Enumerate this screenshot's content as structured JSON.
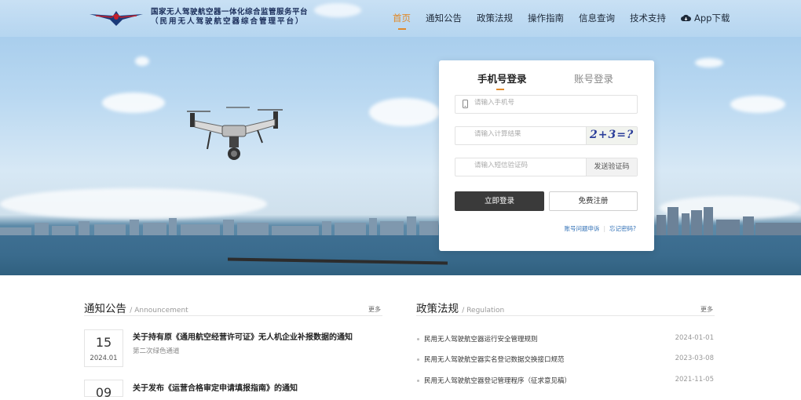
{
  "header": {
    "logo_line1": "国家无人驾驶航空器一体化综合监管服务平台",
    "logo_line2": "（民用无人驾驶航空器综合管理平台）",
    "nav": [
      {
        "label": "首页",
        "active": true
      },
      {
        "label": "通知公告",
        "active": false
      },
      {
        "label": "政策法规",
        "active": false
      },
      {
        "label": "操作指南",
        "active": false
      },
      {
        "label": "信息查询",
        "active": false
      },
      {
        "label": "技术支持",
        "active": false
      }
    ],
    "app_download": "App下载"
  },
  "login": {
    "tabs": [
      "手机号登录",
      "账号登录"
    ],
    "phone_placeholder": "请输入手机号",
    "calc_placeholder": "请输入计算结果",
    "captcha_text": "2+3=?",
    "sms_placeholder": "请输入短信验证码",
    "send_code": "发送验证码",
    "login_button": "立即登录",
    "register_button": "免费注册",
    "account_issue_link": "账号问题申诉",
    "forgot_password_link": "忘记密码?"
  },
  "notices": {
    "title": "通知公告",
    "title_en": "Announcement",
    "more": "更多",
    "items": [
      {
        "day": "15",
        "ym": "2024.01",
        "title": "关于持有原《通用航空经营许可证》无人机企业补报数据的通知",
        "sub": "第二次绿色通道"
      },
      {
        "day": "09",
        "ym": "",
        "title": "关于发布《运营合格审定申请填报指南》的通知",
        "sub": ""
      }
    ]
  },
  "policies": {
    "title": "政策法规",
    "title_en": "Regulation",
    "more": "更多",
    "items": [
      {
        "title": "民用无人驾驶航空器运行安全管理规则",
        "date": "2024-01-01"
      },
      {
        "title": "民用无人驾驶航空器实名登记数据交换接口规范",
        "date": "2023-03-08"
      },
      {
        "title": "民用无人驾驶航空器登记管理程序（征求意见稿）",
        "date": "2021-11-05"
      }
    ]
  },
  "colors": {
    "accent": "#e0892a",
    "primary_dark": "#3a3a3a",
    "link": "#2f6fb5"
  }
}
